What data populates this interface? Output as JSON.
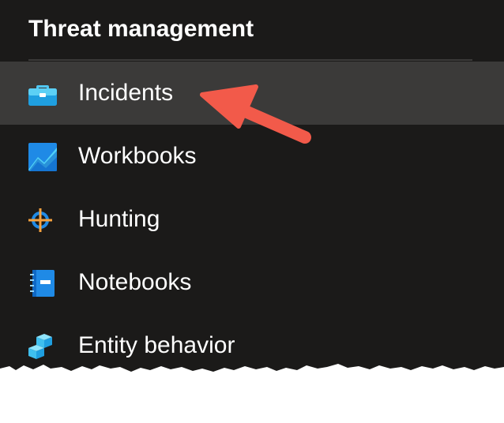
{
  "panel": {
    "section_title": "Threat management",
    "items": [
      {
        "label": "Incidents",
        "icon": "briefcase-icon",
        "active": true
      },
      {
        "label": "Workbooks",
        "icon": "chart-trend-icon",
        "active": false
      },
      {
        "label": "Hunting",
        "icon": "crosshair-icon",
        "active": false
      },
      {
        "label": "Notebooks",
        "icon": "notebook-icon",
        "active": false
      },
      {
        "label": "Entity behavior",
        "icon": "cubes-icon",
        "active": false
      }
    ]
  },
  "colors": {
    "panel_background": "#1b1a19",
    "active_item_background": "#3b3a39",
    "text": "#ffffff",
    "annotation_arrow": "#f25a4a"
  }
}
